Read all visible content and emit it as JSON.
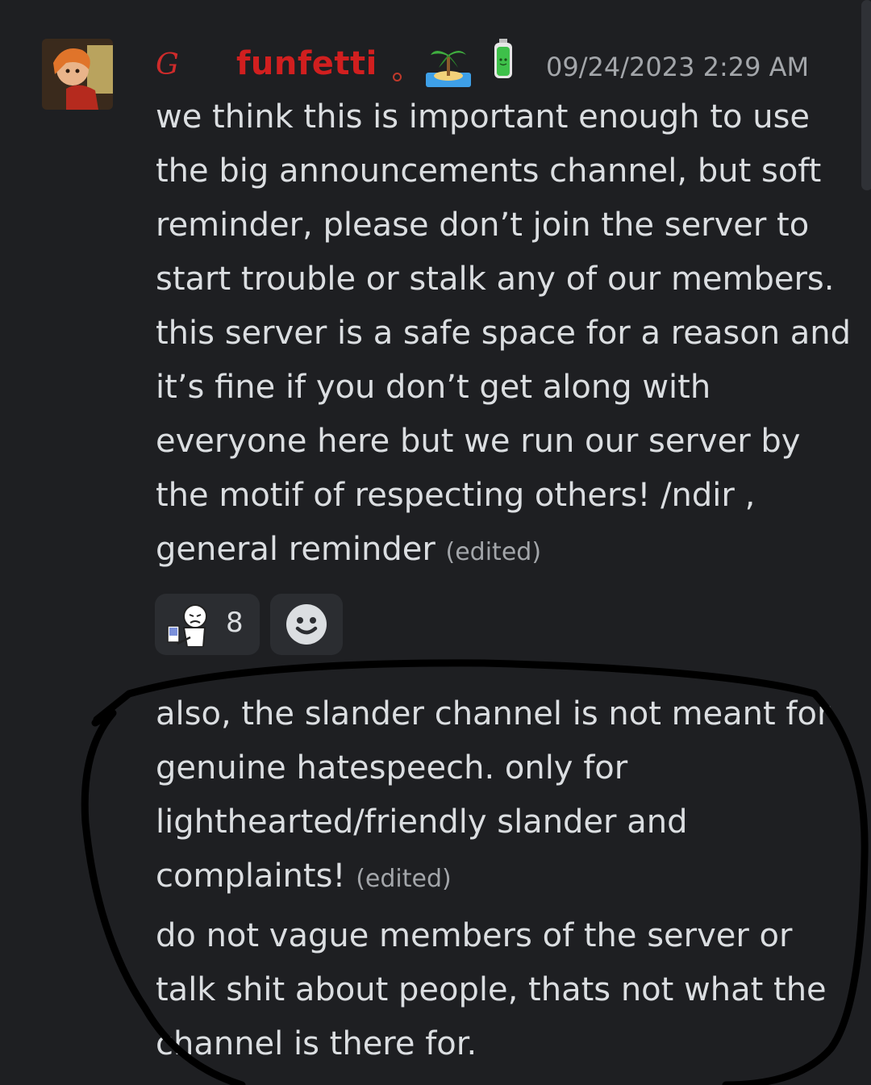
{
  "message": {
    "author": {
      "role_glyph": "G",
      "username": "funfetti",
      "badges": [
        "island-icon",
        "battery-icon"
      ]
    },
    "timestamp": "09/24/2023 2:29 AM",
    "first_text": "we think this is important enough to use the big announcements channel, but soft reminder, please don’t join the server to start trouble or stalk any of our members. this server is a safe space for a reason and it’s fine if you don’t get along with everyone here but we run our server by the motif of respecting others! /ndir , general reminder",
    "first_edited": "(edited)",
    "reactions": [
      {
        "emoji": "sad-computer-emoji",
        "count": "8"
      }
    ],
    "add_reaction_icon": "smile-icon",
    "followups": [
      {
        "text": "also, the slander channel is not meant for genuine hatespeech. only for lighthearted/friendly slander and complaints!",
        "edited": "(edited)"
      },
      {
        "text": "do not vague members of the server or talk shit about people, thats not what the channel is there for.",
        "edited": ""
      }
    ]
  },
  "colors": {
    "background": "#1e1f22",
    "username": "#d11f1f",
    "text": "#dbdee1",
    "muted": "#a3a6aa",
    "reaction_bg": "#2b2d31",
    "annotation": "#000000"
  }
}
